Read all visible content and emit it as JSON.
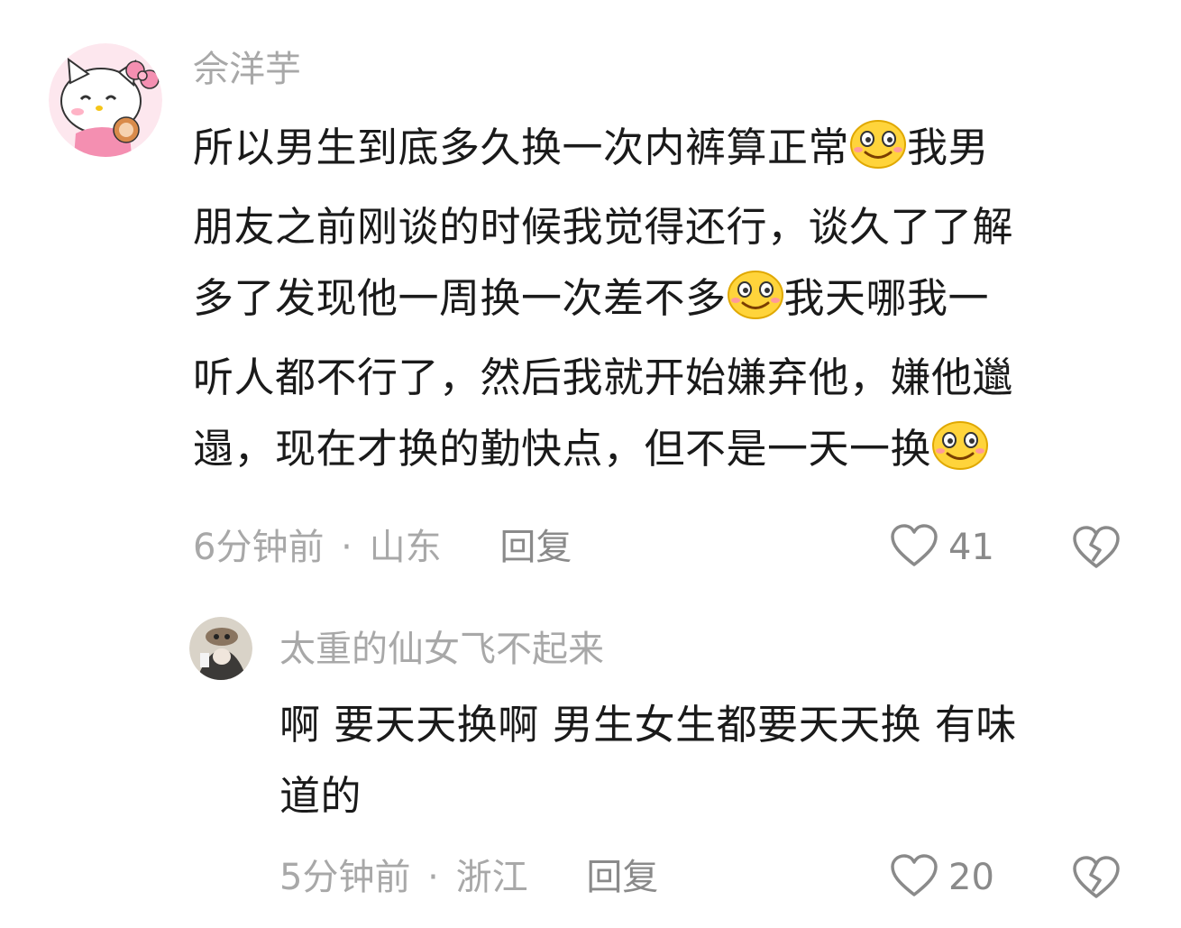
{
  "comments": [
    {
      "username": "佘洋芋",
      "text": {
        "l1": "所以男生到底多久换一次内裤算正常",
        "l1b": "我男",
        "l2": "朋友之前刚谈的时候我觉得还行，谈久了了解",
        "l3": "多了发现他一周换一次差不多",
        "l3b": "我天哪我一",
        "l4": "听人都不行了，然后我就开始嫌弃他，嫌他邋",
        "l5": "遢，现在才换的勤快点，但不是一天一换"
      },
      "time": "6分钟前",
      "separator": "·",
      "location": "山东",
      "reply_label": "回复",
      "likes": "41",
      "emoji_icon": "smile-emoji-icon"
    },
    {
      "username": "太重的仙女飞不起来",
      "text": {
        "l1": "啊 要天天换啊 男生女生都要天天换 有味",
        "l2": "道的"
      },
      "time": "5分钟前",
      "separator": "·",
      "location": "浙江",
      "reply_label": "回复",
      "likes": "20"
    }
  ],
  "colors": {
    "text": "#1a1a1a",
    "secondary": "#a8a8a8",
    "icon": "#8a8a8a"
  }
}
